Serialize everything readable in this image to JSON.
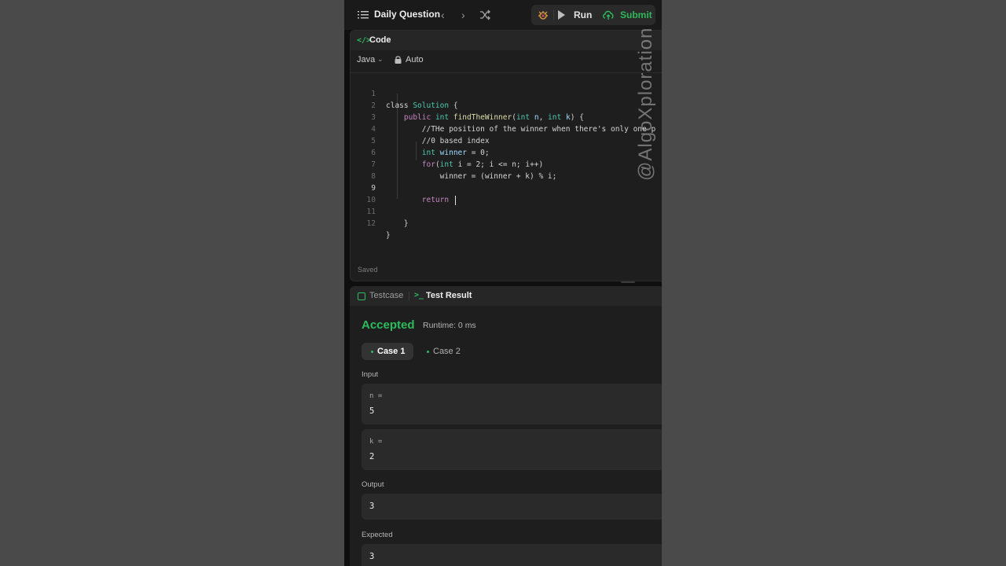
{
  "topbar": {
    "title": "Daily Question",
    "run_label": "Run",
    "submit_label": "Submit"
  },
  "code_panel": {
    "title": "Code",
    "language": "Java",
    "autosave": "Auto",
    "status": "Saved"
  },
  "code_lines": [
    {
      "n": "1",
      "text": "class Solution {"
    },
    {
      "n": "2",
      "text": "    public int findTheWinner(int n, int k) {"
    },
    {
      "n": "3",
      "text": "        //THe position of the winner when there's only one p"
    },
    {
      "n": "4",
      "text": "        //0 based index"
    },
    {
      "n": "5",
      "text": "        int winner = 0;"
    },
    {
      "n": "6",
      "text": "        for(int i = 2; i <= n; i++)"
    },
    {
      "n": "7",
      "text": "            winner = (winner + k) % i;"
    },
    {
      "n": "8",
      "text": ""
    },
    {
      "n": "9",
      "text": "        return "
    },
    {
      "n": "10",
      "text": ""
    },
    {
      "n": "11",
      "text": "    }"
    },
    {
      "n": "12",
      "text": "}"
    }
  ],
  "result_panel": {
    "tab_testcase": "Testcase",
    "tab_result": "Test Result",
    "verdict": "Accepted",
    "runtime": "Runtime: 0 ms",
    "cases": [
      "Case 1",
      "Case 2"
    ],
    "input_label": "Input",
    "inputs": [
      {
        "name": "n =",
        "value": "5"
      },
      {
        "name": "k =",
        "value": "2"
      }
    ],
    "output_label": "Output",
    "output_value": "3",
    "expected_label": "Expected",
    "expected_value": "3"
  },
  "watermark": "@AlgoXploration",
  "colors": {
    "accent_green": "#2cbb5d",
    "keyword": "#c586c0",
    "type": "#4ec9b0",
    "function": "#dcdcaa",
    "comment": "#6a9955"
  }
}
